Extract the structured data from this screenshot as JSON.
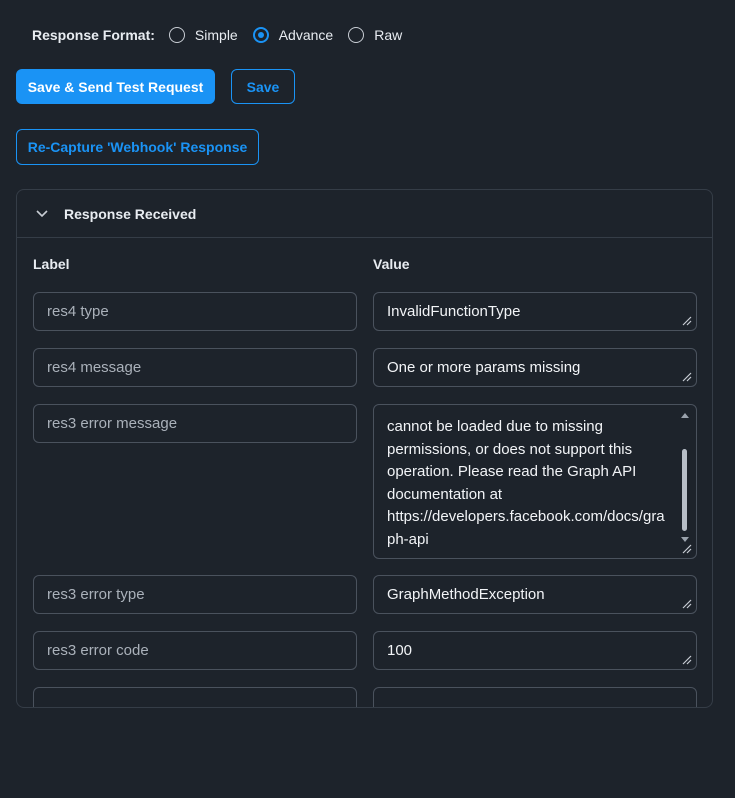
{
  "response_format": {
    "label": "Response Format:",
    "options": [
      {
        "label": "Simple",
        "checked": false
      },
      {
        "label": "Advance",
        "checked": true
      },
      {
        "label": "Raw",
        "checked": false
      }
    ]
  },
  "buttons": {
    "save_send": "Save & Send Test Request",
    "save": "Save",
    "recapture": "Re-Capture 'Webhook' Response"
  },
  "panel": {
    "title": "Response Received",
    "label_header": "Label",
    "value_header": "Value",
    "rows": [
      {
        "label": "res4 type",
        "value": "InvalidFunctionType"
      },
      {
        "label": "res4 message",
        "value": "One or more params missing"
      },
      {
        "label": "res3 error message",
        "value": "cannot be loaded due to missing permissions, or does not support this operation. Please read the Graph API documentation at https://developers.facebook.com/docs/graph-api"
      },
      {
        "label": "res3 error type",
        "value": "GraphMethodException"
      },
      {
        "label": "res3 error code",
        "value": "100"
      },
      {
        "label": "",
        "value": ""
      }
    ]
  },
  "colors": {
    "background": "#1d232b",
    "accent": "#1a93f5",
    "border": "#4a525d"
  }
}
